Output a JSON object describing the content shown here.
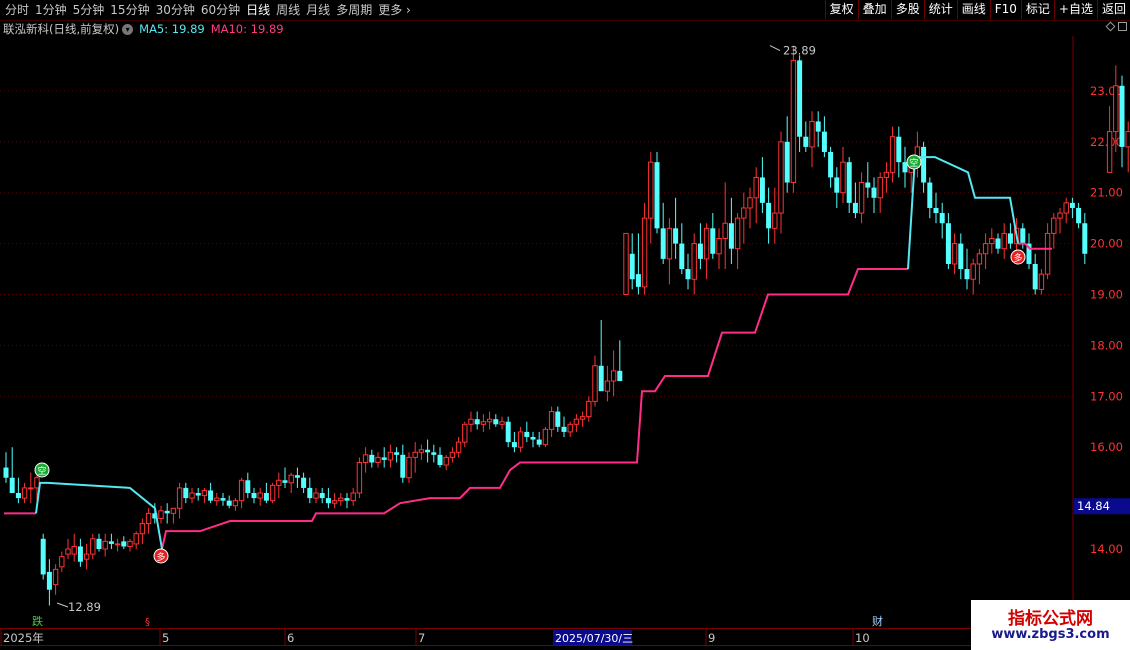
{
  "toolbar": {
    "periods": [
      "分时",
      "1分钟",
      "5分钟",
      "15分钟",
      "30分钟",
      "60分钟",
      "日线",
      "周线",
      "月线",
      "多周期",
      "更多"
    ],
    "active": "日线",
    "right_buttons": [
      "复权",
      "叠加",
      "多股",
      "统计",
      "画线",
      "F10",
      "标记",
      "+自选",
      "返回"
    ]
  },
  "infobar": {
    "title": "联泓新科(日线,前复权)",
    "ma5_label": "MA5: 19.89",
    "ma10_label": "MA10: 19.89"
  },
  "price_axis": {
    "ticks": [
      "23.00",
      "22.00",
      "21.00",
      "20.00",
      "19.00",
      "18.00",
      "17.00",
      "16.00",
      "15.00",
      "14.00"
    ],
    "current": "14.84",
    "current_bg": "#0a0a8c"
  },
  "annotations": {
    "high": "23.89",
    "low": "12.89",
    "buy_label": "空",
    "sell_label": "多"
  },
  "date_axis": {
    "labels": [
      "2025年",
      "5",
      "6",
      "7",
      "9",
      "10"
    ],
    "highlight": "2025/07/30/三",
    "markers": [
      "跌",
      "财"
    ]
  },
  "colors": {
    "up": "#ff3333",
    "down": "#54ffff",
    "ma5": "#55e8f0",
    "ma10": "#ff2d88",
    "grid": "#5a0000"
  },
  "watermark": {
    "line1": "指标公式网",
    "line2": "www.zbgs3.com"
  },
  "chart_data": {
    "type": "candlestick",
    "price_min": 13.4,
    "price_max": 24.4,
    "candles": [
      [
        15.6,
        15.9,
        15.3,
        15.4
      ],
      [
        15.4,
        16.0,
        15.1,
        15.1
      ],
      [
        15.1,
        15.4,
        14.9,
        15.0
      ],
      [
        15.0,
        15.3,
        14.9,
        15.2
      ],
      [
        15.2,
        15.5,
        14.9,
        15.2
      ],
      [
        15.2,
        15.6,
        14.95,
        15.4
      ],
      [
        14.2,
        14.3,
        13.4,
        13.5
      ],
      [
        13.55,
        13.8,
        12.89,
        13.2
      ],
      [
        13.3,
        13.7,
        13.1,
        13.6
      ],
      [
        13.65,
        13.95,
        13.55,
        13.85
      ],
      [
        13.9,
        14.2,
        13.8,
        14.0
      ],
      [
        13.9,
        14.3,
        13.75,
        14.05
      ],
      [
        14.05,
        14.2,
        13.65,
        13.75
      ],
      [
        13.8,
        14.1,
        13.6,
        13.9
      ],
      [
        13.9,
        14.3,
        13.8,
        14.2
      ],
      [
        14.2,
        14.3,
        13.95,
        14.0
      ],
      [
        14.0,
        14.3,
        13.85,
        14.15
      ],
      [
        14.15,
        14.3,
        14.0,
        14.1
      ],
      [
        14.1,
        14.2,
        13.95,
        14.1
      ],
      [
        14.15,
        14.25,
        14.0,
        14.05
      ],
      [
        14.05,
        14.2,
        13.95,
        14.15
      ],
      [
        14.1,
        14.35,
        14.0,
        14.3
      ],
      [
        14.3,
        14.6,
        14.1,
        14.5
      ],
      [
        14.5,
        14.8,
        14.3,
        14.7
      ],
      [
        14.7,
        14.9,
        14.5,
        14.6
      ],
      [
        14.6,
        14.85,
        14.5,
        14.75
      ],
      [
        14.75,
        14.9,
        14.5,
        14.7
      ],
      [
        14.7,
        14.8,
        14.5,
        14.8
      ],
      [
        14.8,
        15.3,
        14.6,
        15.2
      ],
      [
        15.2,
        15.3,
        14.9,
        15.0
      ],
      [
        15.0,
        15.2,
        14.9,
        15.1
      ],
      [
        15.1,
        15.2,
        14.95,
        15.05
      ],
      [
        15.05,
        15.2,
        14.9,
        15.15
      ],
      [
        15.15,
        15.3,
        14.9,
        14.95
      ],
      [
        14.95,
        15.1,
        14.85,
        15.0
      ],
      [
        15.0,
        15.1,
        14.85,
        14.95
      ],
      [
        14.95,
        15.05,
        14.8,
        14.85
      ],
      [
        14.85,
        15.0,
        14.75,
        14.95
      ],
      [
        14.95,
        15.4,
        14.8,
        15.35
      ],
      [
        15.35,
        15.5,
        15.0,
        15.1
      ],
      [
        15.1,
        15.2,
        14.9,
        15.0
      ],
      [
        15.0,
        15.2,
        14.85,
        15.1
      ],
      [
        15.1,
        15.3,
        14.9,
        14.95
      ],
      [
        14.95,
        15.3,
        14.9,
        15.25
      ],
      [
        15.25,
        15.5,
        15.0,
        15.35
      ],
      [
        15.35,
        15.6,
        15.2,
        15.3
      ],
      [
        15.3,
        15.5,
        15.1,
        15.45
      ],
      [
        15.45,
        15.6,
        15.2,
        15.4
      ],
      [
        15.4,
        15.5,
        15.1,
        15.2
      ],
      [
        15.2,
        15.4,
        14.9,
        15.0
      ],
      [
        15.0,
        15.2,
        14.9,
        15.1
      ],
      [
        15.1,
        15.2,
        14.9,
        15.0
      ],
      [
        15.0,
        15.2,
        14.8,
        14.9
      ],
      [
        14.9,
        15.1,
        14.8,
        14.95
      ],
      [
        14.95,
        15.1,
        14.85,
        15.0
      ],
      [
        15.0,
        15.1,
        14.8,
        14.95
      ],
      [
        14.95,
        15.2,
        14.85,
        15.1
      ],
      [
        15.1,
        15.8,
        15.0,
        15.7
      ],
      [
        15.7,
        16.0,
        15.5,
        15.85
      ],
      [
        15.85,
        15.95,
        15.6,
        15.7
      ],
      [
        15.7,
        15.9,
        15.6,
        15.8
      ],
      [
        15.8,
        16.0,
        15.6,
        15.75
      ],
      [
        15.75,
        16.05,
        15.6,
        15.9
      ],
      [
        15.9,
        16.0,
        15.7,
        15.85
      ],
      [
        15.85,
        16.05,
        15.3,
        15.4
      ],
      [
        15.4,
        15.9,
        15.3,
        15.8
      ],
      [
        15.8,
        16.1,
        15.5,
        15.9
      ],
      [
        15.9,
        16.05,
        15.75,
        15.95
      ],
      [
        15.95,
        16.15,
        15.7,
        15.9
      ],
      [
        15.9,
        16.05,
        15.7,
        15.85
      ],
      [
        15.85,
        16.0,
        15.6,
        15.65
      ],
      [
        15.65,
        15.85,
        15.55,
        15.8
      ],
      [
        15.8,
        16.0,
        15.7,
        15.9
      ],
      [
        15.9,
        16.2,
        15.8,
        16.1
      ],
      [
        16.1,
        16.5,
        16.0,
        16.45
      ],
      [
        16.45,
        16.7,
        16.3,
        16.55
      ],
      [
        16.55,
        16.7,
        16.35,
        16.45
      ],
      [
        16.45,
        16.65,
        16.3,
        16.5
      ],
      [
        16.5,
        16.7,
        16.35,
        16.55
      ],
      [
        16.55,
        16.65,
        16.4,
        16.45
      ],
      [
        16.45,
        16.6,
        16.35,
        16.5
      ],
      [
        16.5,
        16.6,
        16.0,
        16.1
      ],
      [
        16.1,
        16.3,
        15.9,
        16.0
      ],
      [
        16.0,
        16.4,
        15.9,
        16.3
      ],
      [
        16.3,
        16.5,
        16.1,
        16.2
      ],
      [
        16.2,
        16.3,
        16.0,
        16.15
      ],
      [
        16.15,
        16.3,
        16.0,
        16.05
      ],
      [
        16.05,
        16.4,
        16.0,
        16.35
      ],
      [
        16.35,
        16.8,
        16.2,
        16.7
      ],
      [
        16.7,
        16.8,
        16.3,
        16.4
      ],
      [
        16.4,
        16.6,
        16.2,
        16.3
      ],
      [
        16.3,
        16.5,
        16.2,
        16.45
      ],
      [
        16.45,
        16.65,
        16.3,
        16.55
      ],
      [
        16.55,
        16.7,
        16.4,
        16.6
      ],
      [
        16.6,
        17.0,
        16.5,
        16.9
      ],
      [
        16.9,
        17.8,
        16.8,
        17.6
      ],
      [
        17.6,
        18.5,
        17.3,
        17.1
      ],
      [
        17.1,
        17.6,
        16.9,
        17.3
      ],
      [
        17.3,
        17.9,
        17.0,
        17.5
      ],
      [
        17.5,
        18.1,
        17.3,
        17.3
      ],
      [
        19.0,
        20.2,
        19.0,
        20.2
      ],
      [
        19.8,
        20.2,
        19.1,
        19.3
      ],
      [
        19.4,
        20.2,
        19.0,
        19.15
      ],
      [
        19.15,
        20.8,
        19.0,
        20.5
      ],
      [
        20.5,
        21.8,
        20.0,
        21.6
      ],
      [
        21.6,
        21.8,
        20.2,
        20.3
      ],
      [
        20.3,
        20.8,
        19.6,
        19.7
      ],
      [
        19.7,
        20.5,
        19.2,
        20.3
      ],
      [
        20.3,
        20.9,
        19.7,
        20.0
      ],
      [
        20.0,
        20.4,
        19.4,
        19.5
      ],
      [
        19.5,
        19.8,
        19.1,
        19.3
      ],
      [
        19.3,
        20.2,
        19.0,
        20.0
      ],
      [
        20.0,
        20.4,
        19.5,
        19.7
      ],
      [
        19.7,
        20.4,
        19.3,
        20.3
      ],
      [
        20.3,
        20.6,
        19.7,
        19.8
      ],
      [
        19.8,
        20.3,
        19.5,
        20.1
      ],
      [
        20.1,
        21.2,
        19.5,
        20.4
      ],
      [
        20.4,
        20.9,
        19.6,
        19.9
      ],
      [
        19.9,
        20.6,
        19.5,
        20.5
      ],
      [
        20.5,
        21.0,
        20.0,
        20.7
      ],
      [
        20.7,
        21.1,
        20.3,
        20.9
      ],
      [
        20.9,
        21.5,
        20.4,
        21.3
      ],
      [
        21.3,
        21.7,
        20.6,
        20.8
      ],
      [
        20.8,
        21.1,
        20.0,
        20.3
      ],
      [
        20.3,
        21.1,
        20.0,
        20.6
      ],
      [
        20.6,
        22.2,
        20.2,
        22.0
      ],
      [
        22.0,
        22.5,
        21.0,
        21.2
      ],
      [
        21.2,
        23.89,
        21.0,
        23.6
      ],
      [
        23.6,
        23.7,
        21.8,
        22.1
      ],
      [
        22.1,
        22.4,
        21.8,
        21.9
      ],
      [
        21.9,
        22.6,
        21.5,
        22.4
      ],
      [
        22.4,
        22.6,
        21.9,
        22.2
      ],
      [
        22.2,
        22.5,
        21.7,
        21.8
      ],
      [
        21.8,
        21.9,
        21.1,
        21.3
      ],
      [
        21.3,
        21.5,
        20.7,
        21.0
      ],
      [
        21.0,
        21.9,
        20.8,
        21.6
      ],
      [
        21.6,
        21.7,
        20.6,
        20.8
      ],
      [
        20.8,
        21.2,
        20.5,
        20.6
      ],
      [
        20.6,
        21.4,
        20.4,
        21.2
      ],
      [
        21.2,
        21.6,
        20.9,
        21.1
      ],
      [
        21.1,
        21.3,
        20.6,
        20.9
      ],
      [
        20.9,
        21.4,
        20.6,
        21.3
      ],
      [
        21.3,
        21.6,
        21.0,
        21.4
      ],
      [
        21.4,
        22.3,
        21.2,
        22.1
      ],
      [
        22.1,
        22.3,
        21.3,
        21.6
      ],
      [
        21.6,
        21.9,
        21.1,
        21.4
      ],
      [
        21.4,
        21.7,
        21.0,
        21.5
      ],
      [
        21.5,
        22.2,
        21.3,
        21.9
      ],
      [
        21.9,
        22.0,
        21.0,
        21.2
      ],
      [
        21.2,
        21.3,
        20.5,
        20.7
      ],
      [
        20.7,
        21.0,
        20.4,
        20.6
      ],
      [
        20.6,
        20.8,
        20.1,
        20.4
      ],
      [
        20.4,
        20.6,
        19.5,
        19.6
      ],
      [
        19.6,
        20.2,
        19.4,
        20.0
      ],
      [
        20.0,
        20.2,
        19.3,
        19.5
      ],
      [
        19.5,
        19.9,
        19.1,
        19.3
      ],
      [
        19.3,
        19.7,
        19.0,
        19.6
      ],
      [
        19.6,
        19.9,
        19.2,
        19.8
      ],
      [
        19.8,
        20.2,
        19.5,
        20.0
      ],
      [
        20.0,
        20.3,
        19.8,
        20.1
      ],
      [
        20.1,
        20.2,
        19.8,
        19.9
      ],
      [
        19.9,
        20.4,
        19.7,
        20.2
      ],
      [
        20.2,
        20.4,
        19.9,
        20.0
      ],
      [
        20.0,
        20.5,
        19.8,
        20.3
      ],
      [
        20.3,
        20.4,
        19.9,
        20.0
      ],
      [
        20.0,
        20.2,
        19.5,
        19.6
      ],
      [
        19.6,
        19.8,
        19.0,
        19.1
      ],
      [
        19.1,
        19.5,
        19.0,
        19.4
      ],
      [
        19.4,
        20.4,
        19.3,
        20.2
      ],
      [
        20.2,
        20.6,
        19.9,
        20.5
      ],
      [
        20.5,
        20.7,
        20.2,
        20.6
      ],
      [
        20.6,
        20.9,
        20.4,
        20.8
      ],
      [
        20.8,
        20.9,
        20.5,
        20.7
      ],
      [
        20.7,
        20.8,
        20.3,
        20.4
      ],
      [
        20.4,
        20.6,
        19.6,
        19.8
      ],
      null,
      null,
      null,
      [
        21.4,
        22.7,
        21.5,
        22.2
      ],
      [
        22.2,
        23.5,
        21.8,
        23.1
      ],
      [
        23.1,
        23.3,
        21.5,
        21.9
      ],
      [
        21.9,
        22.4,
        21.4,
        22.2
      ],
      [
        22.2,
        22.4,
        21.3,
        21.6
      ],
      [
        21.6,
        21.9,
        20.9,
        21.1
      ],
      [
        21.1,
        21.4,
        20.8,
        20.9
      ]
    ],
    "ma_upper": [
      [
        0,
        14.7
      ],
      [
        36,
        14.7
      ],
      [
        40,
        15.3
      ],
      [
        42,
        15.4
      ],
      [
        48,
        15.2
      ],
      [
        130,
        15.2
      ],
      [
        155,
        14.8
      ],
      [
        162,
        14.0
      ],
      [
        166,
        14.35
      ],
      [
        230,
        14.6
      ],
      [
        312,
        14.7
      ],
      [
        384,
        14.7
      ],
      [
        400,
        14.9
      ],
      [
        430,
        15.0
      ],
      [
        470,
        15.2
      ],
      [
        500,
        15.5
      ],
      [
        520,
        15.7
      ],
      [
        640,
        15.7
      ],
      [
        642,
        17.1
      ],
      [
        655,
        17.2
      ],
      [
        665,
        17.4
      ],
      [
        708,
        17.4
      ],
      [
        725,
        18.3
      ],
      [
        755,
        18.3
      ],
      [
        768,
        19.0
      ],
      [
        850,
        19.0
      ],
      [
        858,
        19.5
      ],
      [
        908,
        19.5
      ],
      [
        915,
        21.7
      ],
      [
        935,
        21.7
      ],
      [
        968,
        21.4
      ],
      [
        975,
        20.9
      ],
      [
        1010,
        20.9
      ],
      [
        1018,
        20.0
      ],
      [
        1052,
        20.0
      ]
    ]
  }
}
